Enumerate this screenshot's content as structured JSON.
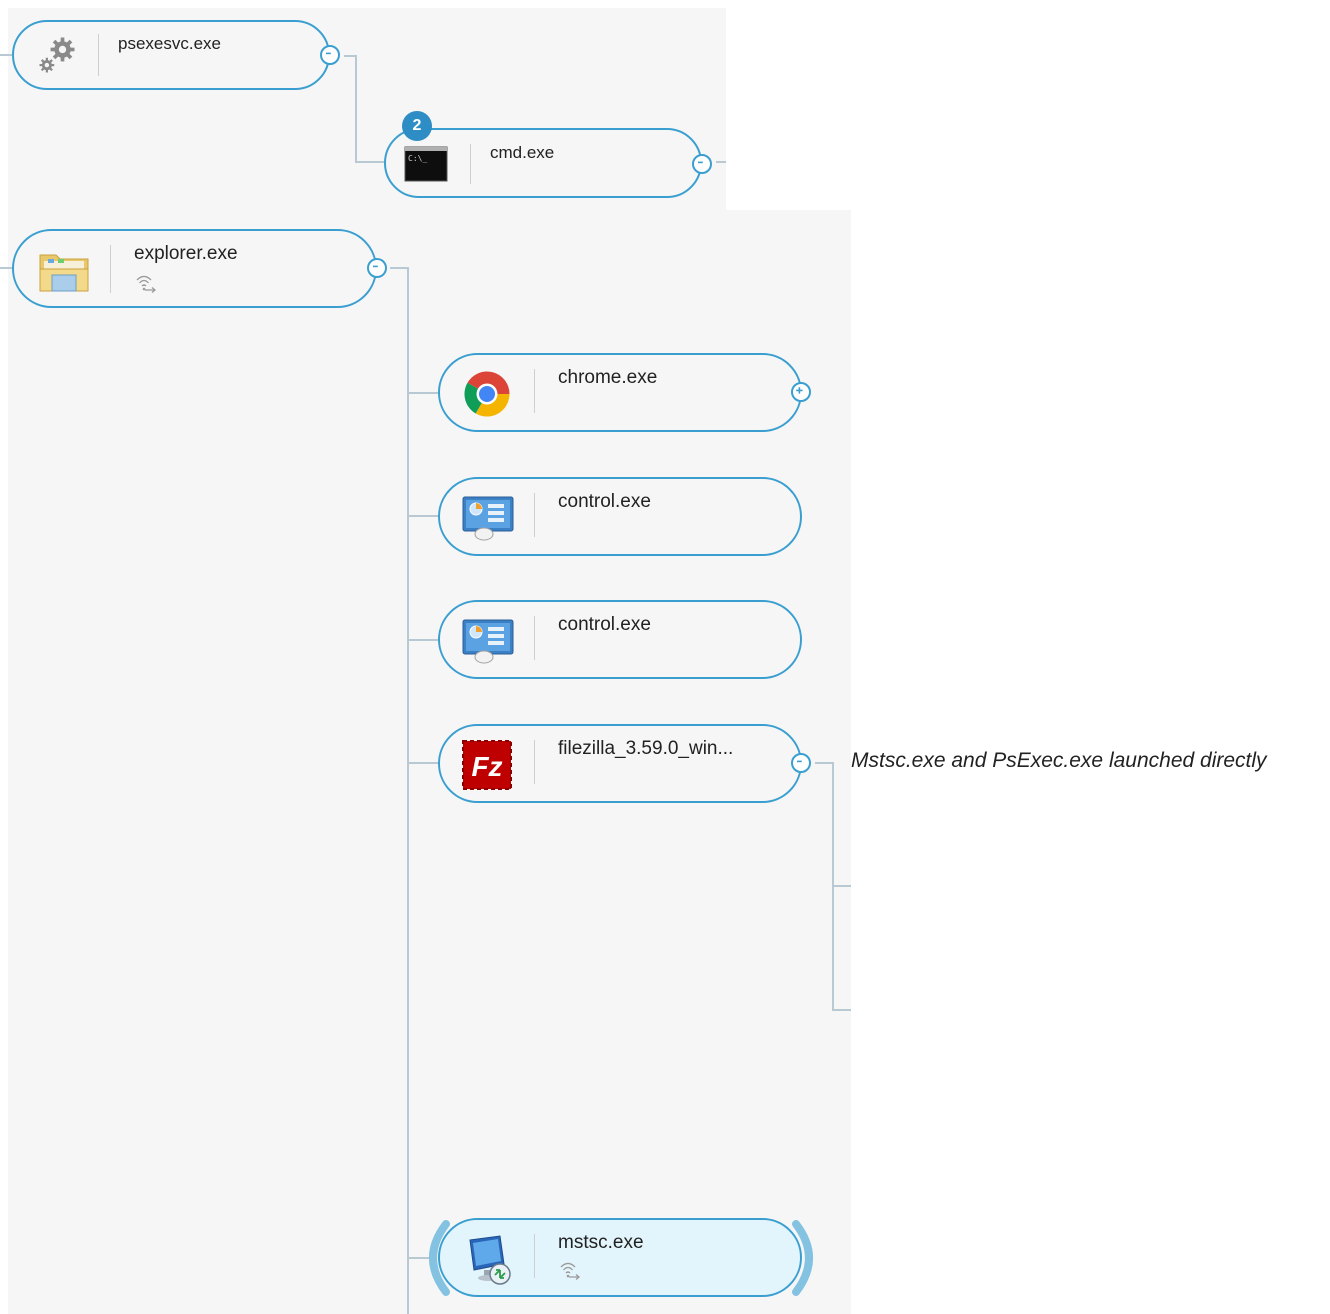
{
  "nodes": {
    "psexesvc": {
      "label": "psexesvc.exe",
      "icon": "gears-icon"
    },
    "cmd": {
      "label": "cmd.exe",
      "icon": "console-icon",
      "badge": "2",
      "icon_text": "C:\\_"
    },
    "explorer": {
      "label": "explorer.exe",
      "icon": "folder-icon",
      "network": true
    },
    "chrome": {
      "label": "chrome.exe",
      "icon": "chrome-icon"
    },
    "control1": {
      "label": "control.exe",
      "icon": "control-panel-icon"
    },
    "control2": {
      "label": "control.exe",
      "icon": "control-panel-icon"
    },
    "filezilla": {
      "label": "filezilla_3.59.0_win...",
      "icon": "filezilla-icon",
      "icon_text": "Fz"
    },
    "mstsc": {
      "label": "mstsc.exe",
      "icon": "remote-desktop-icon",
      "network": true,
      "selected": true
    }
  },
  "annotation": "Mstsc.exe and PsExec.exe launched directly",
  "colors": {
    "node_border": "#3a9fd0",
    "badge": "#2e8dc4",
    "connector": "#b9c9d3",
    "canvas": "#f6f6f6"
  }
}
